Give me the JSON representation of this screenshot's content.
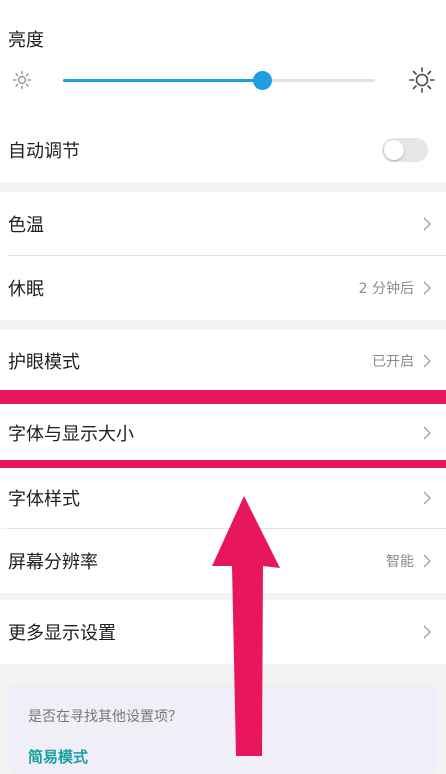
{
  "brightness": {
    "title": "亮度",
    "level_percent": 64,
    "low_icon": "sun-small-icon",
    "high_icon": "sun-large-icon"
  },
  "auto_adjust": {
    "label": "自动调节",
    "enabled": false
  },
  "settings": {
    "color_temp": {
      "label": "色温",
      "value": ""
    },
    "sleep": {
      "label": "休眠",
      "value": "2 分钟后"
    },
    "eye_comfort": {
      "label": "护眼模式",
      "value": "已开启"
    },
    "font_display_size": {
      "label": "字体与显示大小",
      "value": ""
    },
    "font_style": {
      "label": "字体样式",
      "value": ""
    },
    "resolution": {
      "label": "屏幕分辨率",
      "value": "智能"
    },
    "more_display": {
      "label": "更多显示设置",
      "value": ""
    }
  },
  "suggestion": {
    "title": "是否在寻找其他设置项？",
    "link": "简易模式"
  },
  "colors": {
    "accent": "#1e9fe0",
    "highlight": "#e8175d",
    "link": "#1aa0a3"
  }
}
